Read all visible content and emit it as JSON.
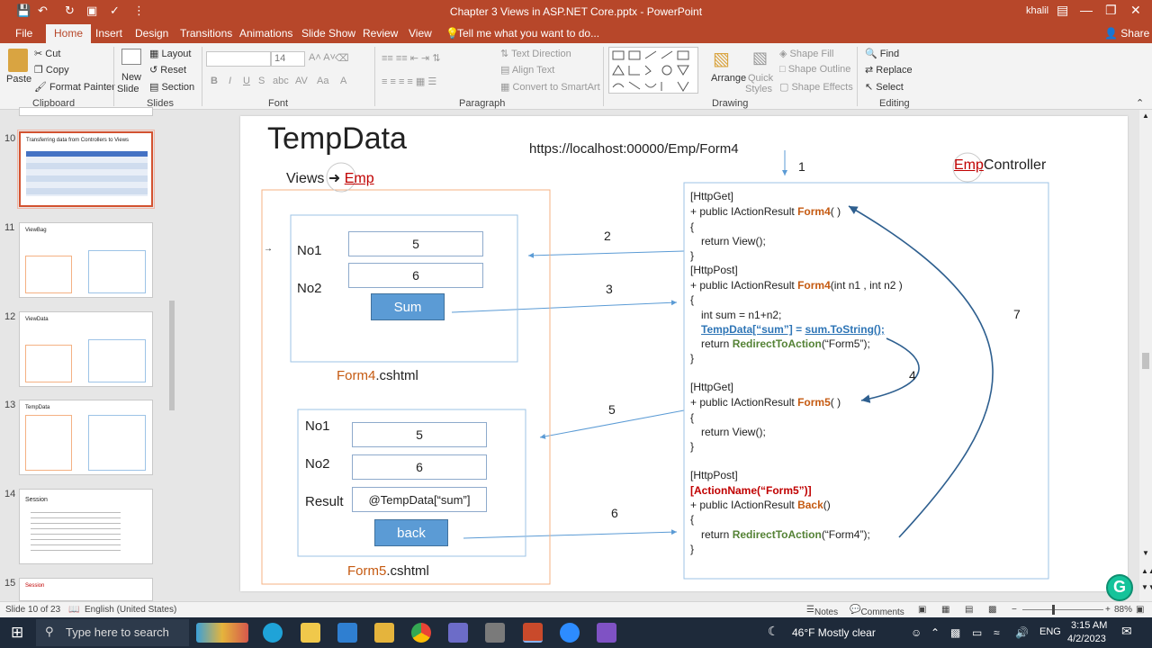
{
  "window": {
    "title": "Chapter 3  Views in ASP.NET Core.pptx  -  PowerPoint",
    "user": "khalil",
    "share": "Share"
  },
  "tabs": [
    "File",
    "Home",
    "Insert",
    "Design",
    "Transitions",
    "Animations",
    "Slide Show",
    "Review",
    "View"
  ],
  "tell_me": "Tell me what you want to do...",
  "ribbon": {
    "clipboard": {
      "label": "Clipboard",
      "paste": "Paste",
      "cut": "Cut",
      "copy": "Copy",
      "format_painter": "Format Painter"
    },
    "slides": {
      "label": "Slides",
      "new_slide": "New",
      "new_slide2": "Slide",
      "layout": "Layout",
      "reset": "Reset",
      "section": "Section"
    },
    "font": {
      "label": "Font",
      "size": "14"
    },
    "paragraph": {
      "label": "Paragraph",
      "text_direction": "Text Direction",
      "align_text": "Align Text",
      "smartart": "Convert to SmartArt"
    },
    "drawing": {
      "label": "Drawing",
      "arrange": "Arrange",
      "quick": "Quick",
      "styles": "Styles",
      "shape_fill": "Shape Fill",
      "shape_outline": "Shape Outline",
      "shape_effects": "Shape Effects"
    },
    "editing": {
      "label": "Editing",
      "find": "Find",
      "replace": "Replace",
      "select": "Select"
    }
  },
  "thumbnails": [
    {
      "num": "10",
      "title": "Transferring data from Controllers to Views",
      "selected": true
    },
    {
      "num": "11",
      "title": "ViewBag",
      "selected": false
    },
    {
      "num": "12",
      "title": "ViewData",
      "selected": false
    },
    {
      "num": "13",
      "title": "TempData",
      "selected": false
    },
    {
      "num": "14",
      "title": "Session",
      "selected": false
    },
    {
      "num": "15",
      "title": "Session",
      "selected": false
    }
  ],
  "slide": {
    "title": "TempData",
    "url": "https://localhost:00000/Emp/Form4",
    "views_label": "Views",
    "views_folder": "Emp",
    "controller_prefix": "Emp",
    "controller_suffix": "Controller",
    "form4": {
      "no1_label": "No1",
      "no1_value": "5",
      "no2_label": "No2",
      "no2_value": "6",
      "button": "Sum",
      "file_prefix": "Form4",
      "file_suffix": ".cshtml"
    },
    "form5": {
      "no1_label": "No1",
      "no1_value": "5",
      "no2_label": "No2",
      "no2_value": "6",
      "result_label": "Result",
      "result_value": "@TempData[“sum”]",
      "button": "back",
      "file_prefix": "Form5",
      "file_suffix": ".cshtml"
    },
    "steps": [
      "1",
      "2",
      "3",
      "4",
      "5",
      "6",
      "7"
    ],
    "code": {
      "httpget1": "[HttpGet]",
      "sig1_pre": "+ public IActionResult ",
      "sig1_name": "Form4",
      "sig1_post": "( )",
      "brace_open": "{",
      "brace_close": "}",
      "return_view": "return View();",
      "httppost1": "[HttpPost]",
      "sig2_pre": "+ public IActionResult ",
      "sig2_name": "Form4",
      "sig2_post": "(int n1 , int n2 )",
      "sum_line": "int sum = n1+n2;",
      "tempdata_a": "TempData[“sum”]",
      "tempdata_b": " = ",
      "tempdata_c": "sum.ToString();",
      "redirect1_pre": "return ",
      "redirect1_name": "RedirectToAction",
      "redirect1_post": "(“Form5”);",
      "httpget2": "[HttpGet]",
      "sig3_pre": "+ public IActionResult ",
      "sig3_name": "Form5",
      "sig3_post": "( )",
      "httppost2": "[HttpPost]",
      "action_name": "[ActionName(“Form5”)]",
      "sig4_pre": "+ public IActionResult ",
      "sig4_name": "Back",
      "sig4_post": "()",
      "redirect2_pre": "return ",
      "redirect2_name": "RedirectToAction",
      "redirect2_post": "(“Form4”);"
    }
  },
  "status": {
    "slide": "Slide 10 of 23",
    "language": "English (United States)",
    "notes": "Notes",
    "comments": "Comments",
    "zoom": "88%"
  },
  "taskbar": {
    "search": "Type here to search",
    "weather": "46°F  Mostly clear",
    "lang": "ENG",
    "time": "3:15 AM",
    "date": "4/2/2023"
  }
}
